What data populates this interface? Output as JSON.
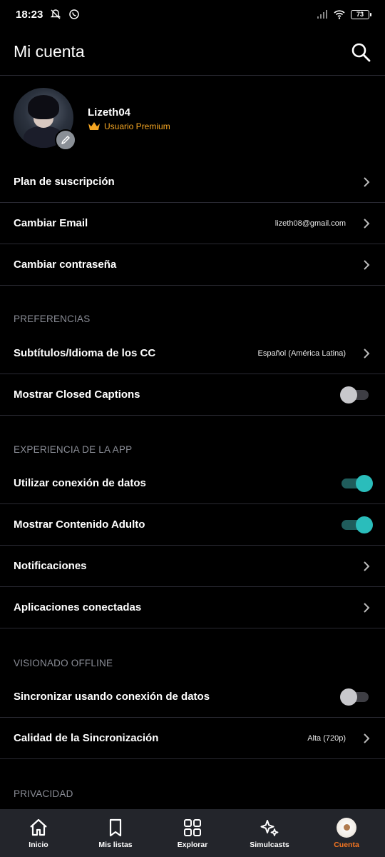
{
  "status_bar": {
    "time": "18:23",
    "battery": "73",
    "icons": [
      "bell-off-icon",
      "whatsapp-icon",
      "signal-icon",
      "wifi-icon",
      "battery-icon"
    ]
  },
  "header": {
    "title": "Mi cuenta",
    "search_icon": "search-icon"
  },
  "profile": {
    "username": "Lizeth04",
    "badge": "Usuario Premium",
    "badge_color": "#f5a623"
  },
  "account_rows": [
    {
      "label": "Plan de suscripción",
      "value": ""
    },
    {
      "label": "Cambiar Email",
      "value": "lizeth08@gmail.com"
    },
    {
      "label": "Cambiar contraseña",
      "value": ""
    }
  ],
  "preferences": {
    "title": "PREFERENCIAS",
    "subtitles": {
      "label": "Subtítulos/Idioma de los CC",
      "value": "Español (América Latina)"
    },
    "closed_captions": {
      "label": "Mostrar Closed Captions",
      "enabled": false
    }
  },
  "app_experience": {
    "title": "EXPERIENCIA DE LA APP",
    "data_connection": {
      "label": "Utilizar conexión de datos",
      "enabled": true
    },
    "adult_content": {
      "label": "Mostrar Contenido Adulto",
      "enabled": true
    },
    "notifications": {
      "label": "Notificaciones"
    },
    "connected_apps": {
      "label": "Aplicaciones conectadas"
    }
  },
  "offline": {
    "title": "VISIONADO OFFLINE",
    "sync_data": {
      "label": "Sincronizar usando conexión de datos",
      "enabled": false
    },
    "sync_quality": {
      "label": "Calidad de la Sincronización",
      "value": "Alta (720p)"
    }
  },
  "privacy": {
    "title": "PRIVACIDAD"
  },
  "colors": {
    "accent": "#f47521",
    "toggle_on": "#2abdbb",
    "divider": "#2a2a33"
  },
  "bottom_nav": [
    {
      "label": "Inicio",
      "icon": "home-icon"
    },
    {
      "label": "Mis listas",
      "icon": "bookmark-icon"
    },
    {
      "label": "Explorar",
      "icon": "grid-icon"
    },
    {
      "label": "Simulcasts",
      "icon": "sparkles-icon"
    },
    {
      "label": "Cuenta",
      "icon": "avatar-icon",
      "active": true
    }
  ]
}
